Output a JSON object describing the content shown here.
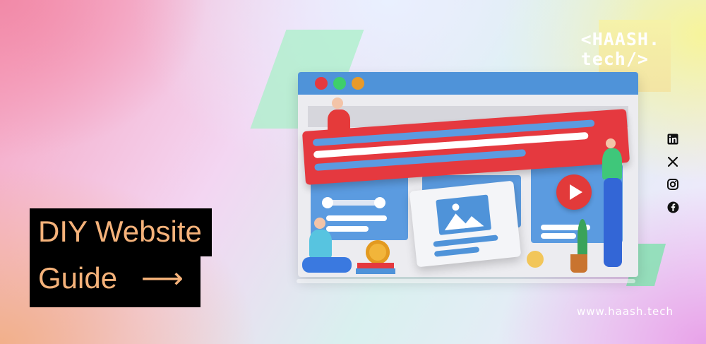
{
  "brand": {
    "logo_line1": "<HAASH.",
    "logo_line2": "tech/>",
    "website": "www.haash.tech"
  },
  "headline": {
    "line1": "DIY Website",
    "line2": "Guide",
    "arrow": "⟶"
  },
  "social": [
    {
      "name": "linkedin-icon",
      "glyph": "in"
    },
    {
      "name": "x-icon",
      "glyph": "𝕏"
    },
    {
      "name": "instagram-icon",
      "glyph": "◎"
    },
    {
      "name": "facebook-icon",
      "glyph": "f"
    }
  ],
  "colors": {
    "headline_text": "#f5b27a",
    "headline_bg": "#000000",
    "window_bar": "#4f93d9",
    "accent_red": "#e5393f"
  }
}
